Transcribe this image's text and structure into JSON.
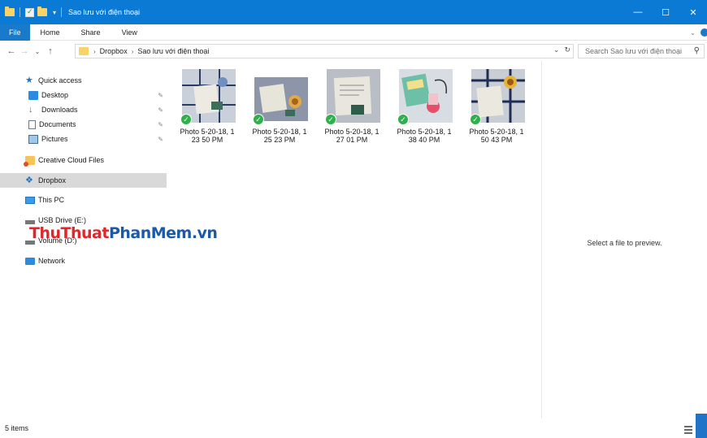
{
  "window": {
    "title": "Sao lưu với điện thoại",
    "minimize_glyph": "—",
    "maximize_glyph": "☐",
    "close_glyph": "✕"
  },
  "ribbon": {
    "tabs": [
      "File",
      "Home",
      "Share",
      "View"
    ]
  },
  "address": {
    "crumbs": [
      "Dropbox",
      "Sao lưu với điện thoại"
    ],
    "search_placeholder": "Search Sao lưu với điện thoại"
  },
  "nav": {
    "quick_access": "Quick access",
    "items": [
      "Desktop",
      "Downloads",
      "Documents",
      "Pictures"
    ],
    "creative_cloud": "Creative Cloud Files",
    "dropbox": "Dropbox",
    "this_pc": "This PC",
    "usb_drive": "USB Drive (E:)",
    "volume": "Volume (D:)",
    "network": "Network"
  },
  "watermark": {
    "part1": "ThuThuat",
    "part2": "PhanMem.vn"
  },
  "files": [
    {
      "line1": "Photo 5-20-18, 1",
      "line2": "23 50 PM"
    },
    {
      "line1": "Photo 5-20-18, 1",
      "line2": "25 23 PM"
    },
    {
      "line1": "Photo 5-20-18, 1",
      "line2": "27 01 PM"
    },
    {
      "line1": "Photo 5-20-18, 1",
      "line2": "38 40 PM"
    },
    {
      "line1": "Photo 5-20-18, 1",
      "line2": "50 43 PM"
    }
  ],
  "preview": {
    "message": "Select a file to preview."
  },
  "status": {
    "item_count": "5 items"
  },
  "colors": {
    "titlebar": "#0a7ad4",
    "file_tab": "#1979ca",
    "selected_nav": "#d9d9d9",
    "sync_check": "#2fb04a"
  }
}
